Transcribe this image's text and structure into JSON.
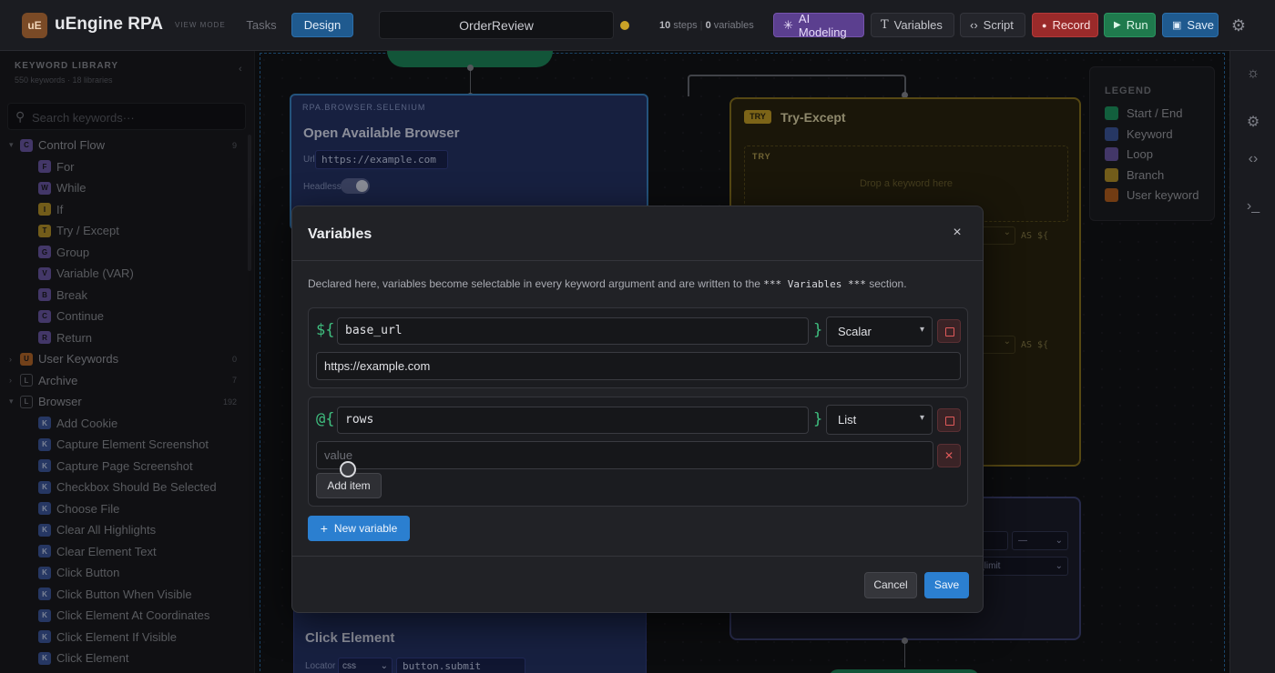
{
  "app": {
    "logo": "uE",
    "title": "uEngine RPA",
    "view_mode": "VIEW MODE"
  },
  "tabs": [
    {
      "label": "Tasks"
    },
    {
      "label": "Design"
    }
  ],
  "document": {
    "name": "OrderReview"
  },
  "stats": {
    "steps": "10",
    "steps_label": "steps",
    "variables": "0",
    "variables_label": "variables"
  },
  "toolbar": {
    "ai_modeling": "AI Modeling",
    "variables": "Variables",
    "script": "Script",
    "record": "Record",
    "run": "Run",
    "save": "Save"
  },
  "sidebar": {
    "title": "KEYWORD LIBRARY",
    "subtitle": "550 keywords · 18 libraries",
    "search_placeholder": "Search keywords···",
    "groups": [
      {
        "label": "Control Flow",
        "badge": "C",
        "count": "9",
        "expanded": true
      },
      {
        "label": "User Keywords",
        "badge": "U",
        "count": "0",
        "expanded": false
      },
      {
        "label": "Archive",
        "badge": "L",
        "count": "7",
        "expanded": false
      },
      {
        "label": "Browser",
        "badge": "L",
        "count": "192",
        "expanded": true
      }
    ],
    "control_flow_items": [
      {
        "label": "For",
        "badge": "F"
      },
      {
        "label": "While",
        "badge": "W"
      },
      {
        "label": "If",
        "badge": "I"
      },
      {
        "label": "Try / Except",
        "badge": "T"
      },
      {
        "label": "Group",
        "badge": "G"
      },
      {
        "label": "Variable (VAR)",
        "badge": "V"
      },
      {
        "label": "Break",
        "badge": "B"
      },
      {
        "label": "Continue",
        "badge": "C"
      },
      {
        "label": "Return",
        "badge": "R"
      }
    ],
    "browser_items": [
      "Add Cookie",
      "Capture Element Screenshot",
      "Capture Page Screenshot",
      "Checkbox Should Be Selected",
      "Choose File",
      "Clear All Highlights",
      "Clear Element Text",
      "Click Button",
      "Click Button When Visible",
      "Click Element At Coordinates",
      "Click Element If Visible",
      "Click Element"
    ],
    "browser_badge": "K"
  },
  "canvas": {
    "open_browser": {
      "library": "RPA.BROWSER.SELENIUM",
      "title": "Open Available Browser",
      "url_label": "Url",
      "url_value": "https://example.com",
      "headless_label": "Headless",
      "headless_on": true
    },
    "try_block": {
      "tag": "TRY",
      "title": "Try-Except",
      "zone_label": "TRY",
      "drop_hint": "Drop a keyword here",
      "as_label": "AS ${"
    },
    "if_block": {
      "select_value": "—",
      "field_value": "on_limit"
    },
    "click_element": {
      "title": "Click Element",
      "locator_label": "Locator",
      "strategy": "css",
      "locator_value": "button.submit"
    }
  },
  "legend": {
    "title": "LEGEND",
    "items": [
      {
        "label": "Start / End",
        "color": "#1e9a63"
      },
      {
        "label": "Keyword",
        "color": "#3e5aa0"
      },
      {
        "label": "Loop",
        "color": "#6d5aa8"
      },
      {
        "label": "Branch",
        "color": "#b9952a"
      },
      {
        "label": "User keyword",
        "color": "#b8621f"
      }
    ]
  },
  "modal": {
    "title": "Variables",
    "description_pre": "Declared here, variables become selectable in every keyword argument and are written to the ",
    "description_code": "*** Variables ***",
    "description_post": " section.",
    "variables": [
      {
        "sigil": "${",
        "close": "}",
        "name": "base_url",
        "type": "Scalar",
        "value": "https://example.com"
      },
      {
        "sigil": "@{",
        "close": "}",
        "name": "rows",
        "type": "List",
        "item_placeholder": "value"
      }
    ],
    "add_item": "Add item",
    "new_variable": "New variable",
    "cancel": "Cancel",
    "save": "Save"
  }
}
